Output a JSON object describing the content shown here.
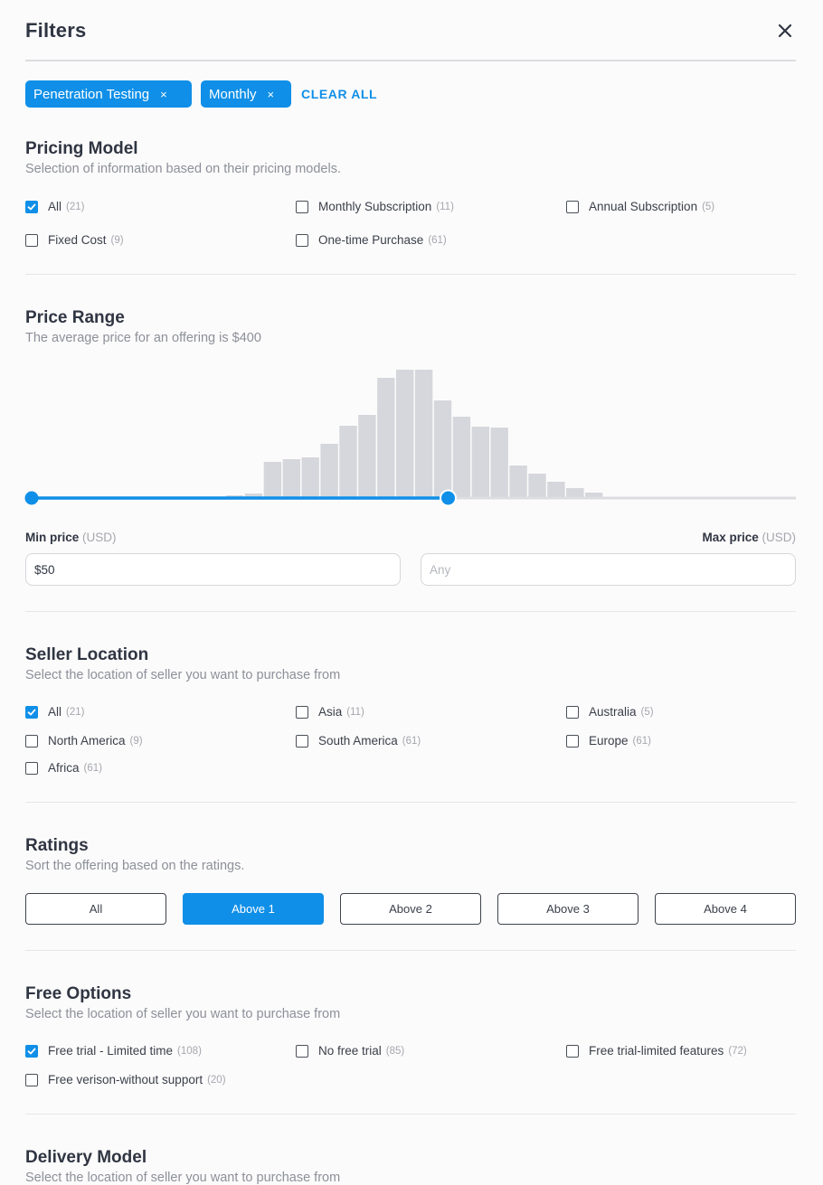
{
  "header": {
    "title": "Filters"
  },
  "chips": [
    {
      "label": "Penetration Testing",
      "remove": "×"
    },
    {
      "label": "Monthly",
      "remove": "×"
    }
  ],
  "clear_all": "CLEAR ALL",
  "pricing": {
    "title": "Pricing Model",
    "subtitle": "Selection of information based on their pricing models.",
    "options": [
      {
        "label": "All",
        "count": "(21)",
        "checked": true
      },
      {
        "label": "Monthly Subscription",
        "count": "(11)",
        "checked": false
      },
      {
        "label": "Annual Subscription",
        "count": "(5)",
        "checked": false
      },
      {
        "label": "Fixed Cost",
        "count": "(9)",
        "checked": false
      },
      {
        "label": "One-time Purchase",
        "count": "(61)",
        "checked": false
      }
    ]
  },
  "price_range": {
    "title": "Price Range",
    "subtitle": "The average price for an offering is $400",
    "histogram": [
      0,
      0,
      0,
      0,
      0,
      0,
      0,
      0,
      0,
      0,
      0,
      3,
      5,
      40,
      43,
      45,
      60,
      80,
      92,
      133,
      142,
      142,
      108,
      90,
      79,
      78,
      36,
      27,
      18,
      11,
      6,
      0,
      0,
      0,
      0,
      0,
      0,
      0,
      0,
      0,
      0
    ],
    "slider_min_fraction": 0.0,
    "slider_max_fraction": 0.545,
    "min_label": "Min price",
    "max_label": "Max price",
    "unit": "(USD)",
    "min_value": "$50",
    "max_placeholder": "Any"
  },
  "seller": {
    "title": "Seller Location",
    "subtitle": "Select the location of seller you want to purchase from",
    "options": [
      {
        "label": "All",
        "count": "(21)",
        "checked": true
      },
      {
        "label": "Asia",
        "count": "(11)",
        "checked": false
      },
      {
        "label": "Australia",
        "count": "(5)",
        "checked": false
      },
      {
        "label": "North America",
        "count": "(9)",
        "checked": false
      },
      {
        "label": "South America",
        "count": "(61)",
        "checked": false
      },
      {
        "label": "Europe",
        "count": "(61)",
        "checked": false
      },
      {
        "label": "Africa",
        "count": "(61)",
        "checked": false
      }
    ]
  },
  "ratings": {
    "title": "Ratings",
    "subtitle": "Sort the offering based on the ratings.",
    "buttons": [
      "All",
      "Above 1",
      "Above 2",
      "Above 3",
      "Above 4"
    ],
    "selected": "Above 1"
  },
  "free": {
    "title": "Free Options",
    "subtitle": "Select the location of seller you want to purchase from",
    "options": [
      {
        "label": "Free trial - Limited time",
        "count": "(108)",
        "checked": true
      },
      {
        "label": "No free trial",
        "count": "(85)",
        "checked": false
      },
      {
        "label": "Free trial-limited features",
        "count": "(72)",
        "checked": false
      },
      {
        "label": "Free verison-without support",
        "count": "(20)",
        "checked": false
      }
    ]
  },
  "delivery": {
    "title": "Delivery Model",
    "subtitle": "Select the location of seller you want to purchase from"
  },
  "colors": {
    "accent": "#0f8fe8",
    "bar": "#d6d7dc",
    "track": "#dcdde1"
  }
}
